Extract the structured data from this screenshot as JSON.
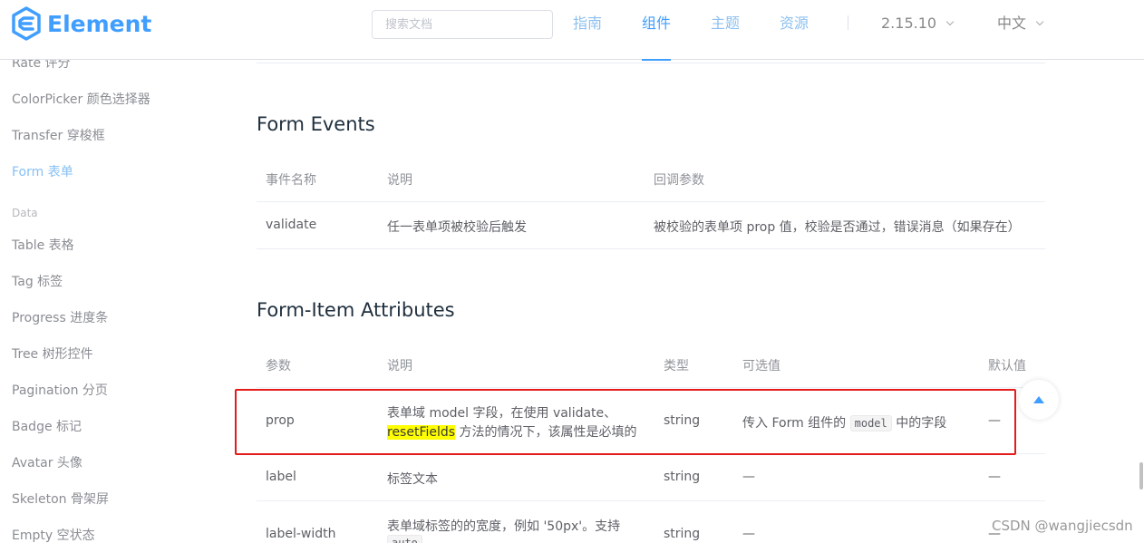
{
  "header": {
    "logo_text": "Element",
    "search_placeholder": "搜索文档",
    "nav": [
      {
        "label": "指南"
      },
      {
        "label": "组件"
      },
      {
        "label": "主题"
      },
      {
        "label": "资源"
      }
    ],
    "version": "2.15.10",
    "language": "中文"
  },
  "sidebar": {
    "items": [
      "Rate 评分",
      "ColorPicker 颜色选择器",
      "Transfer 穿梭框",
      "Form 表单"
    ],
    "group": "Data",
    "data_items": [
      "Table 表格",
      "Tag 标签",
      "Progress 进度条",
      "Tree 树形控件",
      "Pagination 分页",
      "Badge 标记",
      "Avatar 头像",
      "Skeleton 骨架屏",
      "Empty 空状态"
    ]
  },
  "events": {
    "title": "Form Events",
    "headers": [
      "事件名称",
      "说明",
      "回调参数"
    ],
    "rows": [
      [
        "validate",
        "任一表单项被校验后触发",
        "被校验的表单项 prop 值，校验是否通过，错误消息（如果存在）"
      ]
    ]
  },
  "attributes": {
    "title": "Form-Item Attributes",
    "headers": [
      "参数",
      "说明",
      "类型",
      "可选值",
      "默认值"
    ],
    "row_prop": {
      "name": "prop",
      "desc_line1": "表单域 model 字段，在使用 validate、",
      "desc_highlight": "resetFields",
      "desc_line2_rest": " 方法的情况下，该属性是必填的",
      "type": "string",
      "options_before": "传入 Form 组件的 ",
      "options_code": "model",
      "options_after": " 中的字段",
      "default": "—"
    },
    "row_label": {
      "name": "label",
      "desc": "标签文本",
      "type": "string",
      "options": "—",
      "default": "—"
    },
    "row_label_width": {
      "name": "label-width",
      "desc_line1": "表单域标签的的宽度，例如 '50px'。支持",
      "desc_code": "auto",
      "type": "string",
      "options": "—",
      "default": "—"
    }
  },
  "watermark": "CSDN @wangjiecsdn"
}
